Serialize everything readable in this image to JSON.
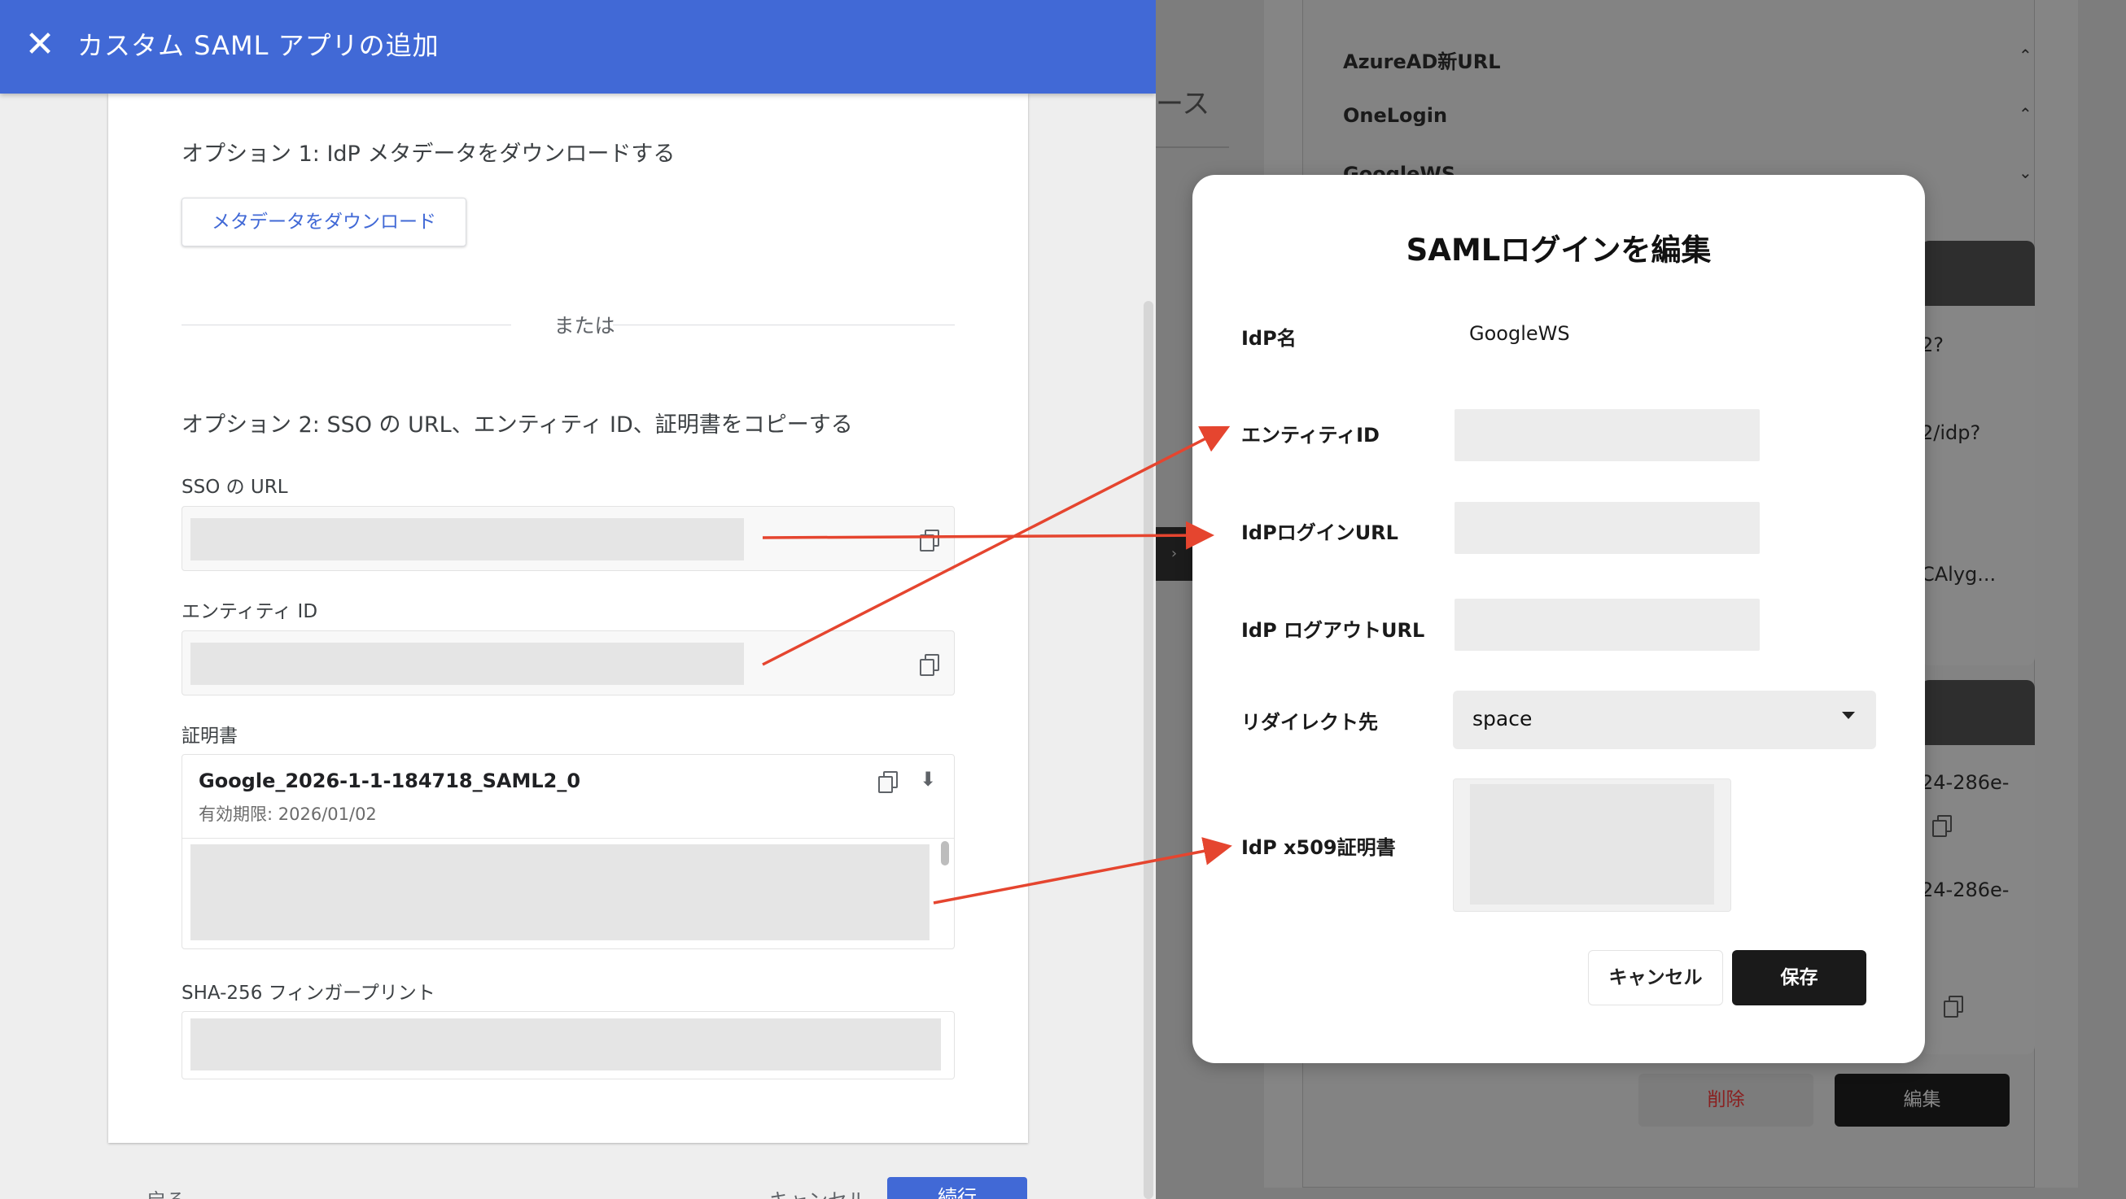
{
  "google_admin": {
    "close_glyph": "✕",
    "title": "カスタム SAML アプリの追加",
    "option1": {
      "title": "オプション 1: IdP メタデータをダウンロードする",
      "download_button": "メタデータをダウンロード"
    },
    "or_text": "または",
    "option2": {
      "title": "オプション 2: SSO の URL、エンティティ ID、証明書をコピーする",
      "sso_url_label": "SSO の URL",
      "entity_id_label": "エンティティ ID",
      "certificate_label": "証明書",
      "certificate": {
        "name": "Google_2026-1-1-184718_SAML2_0",
        "expiry": "有効期限: 2026/01/02"
      },
      "fingerprint_label": "SHA-256 フィンガープリント"
    },
    "footer": {
      "back": "戻る",
      "cancel": "キャンセル",
      "next": "続行"
    },
    "accent_color": "#4169d6"
  },
  "background_app": {
    "tab_fragment": "ース",
    "rows": [
      {
        "label": "AzureAD新URL",
        "caret": "⌃"
      },
      {
        "label": "OneLogin",
        "caret": "⌃"
      },
      {
        "label": "GoogleWS",
        "caret": "⌄"
      }
    ],
    "snippets": [
      "2?",
      "2/idp?",
      "CAlyg...",
      "24-286e-",
      "24-286e-"
    ],
    "delete_button": "削除",
    "edit_button": "編集",
    "delete_color": "#8a1f1f"
  },
  "modal": {
    "title": "SAMLログインを編集",
    "fields": {
      "idp_name_label": "IdP名",
      "idp_name_value": "GoogleWS",
      "entity_id_label": "エンティティID",
      "login_url_label": "IdPログインURL",
      "logout_url_label": "IdP ログアウトURL",
      "redirect_label": "リダイレクト先",
      "redirect_value": "space",
      "cert_label": "IdP x509証明書"
    },
    "cancel_button": "キャンセル",
    "save_button": "保存"
  },
  "annotation_arrow_color": "#e5452f"
}
